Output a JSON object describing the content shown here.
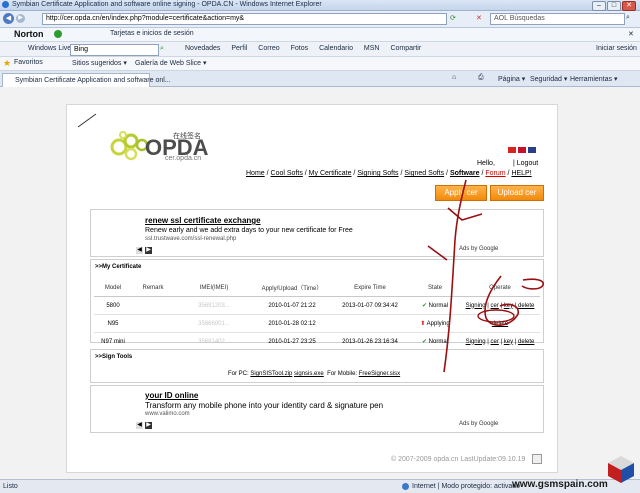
{
  "window": {
    "title": "Symbian Certificate Application and software online signing - OPDA.CN - Windows Internet Explorer",
    "minimize": "–",
    "maximize": "□",
    "close": "✕"
  },
  "address": {
    "url": "http://cer.opda.cn/en/index.php?module=certificate&action=my&",
    "search_placeholder": "AOL Búsquedas"
  },
  "norton": {
    "brand": "Norton",
    "cards": "Tarjetas e inicios de sesión"
  },
  "winlive": {
    "brand": "Windows Live",
    "search_value": "Bing",
    "items": [
      "Novedades",
      "Perfil",
      "Correo",
      "Fotos",
      "Calendario",
      "MSN",
      "Compartir"
    ],
    "signin": "Iniciar sesión"
  },
  "favorites": {
    "label": "Favoritos",
    "items": [
      "Sitios sugeridos ▾",
      "Galería de Web Slice ▾"
    ]
  },
  "tab": {
    "label": "Symbian Certificate Application and software onl...",
    "commands": [
      "Página ▾",
      "Seguridad ▾",
      "Herramientas ▾"
    ]
  },
  "site": {
    "logo_name": "OPDA",
    "logo_cn": "在线签名",
    "logo_domain": "cer.opda.cn",
    "hello": "Hello,",
    "logout": "| Logout",
    "nav": [
      "Home",
      "Cool Softs",
      "My Certificate",
      "Signing Softs",
      "Signed Softs",
      "Software",
      "Forum",
      "HELP!"
    ],
    "apply_btn": "Apply cer",
    "upload_btn": "Upload cer"
  },
  "ad1": {
    "headline": "renew ssl certificate exchange",
    "text": "Renew early and we add extra days to your new certificate for Free",
    "url": "ssl.trustwave.com/ssl-renewal.php",
    "adsby": "Ads by Google"
  },
  "mycert": {
    "section_title": ">>My Certificate",
    "columns": [
      "Model",
      "Remark",
      "IMEI(IMEI)",
      "Apply/Upload（Time）",
      "Expire Time",
      "State",
      "Operate"
    ],
    "rows": [
      {
        "model": "5800",
        "remark": "",
        "imei": "35691203...",
        "apply": "2010-01-07 21:22",
        "expire": "2013-01-07 09:34:42",
        "state": "Normal",
        "state_icon": "check",
        "ops": [
          "Signing",
          "cer",
          "key",
          "delete"
        ]
      },
      {
        "model": "N95",
        "remark": "",
        "imei": "35666001...",
        "apply": "2010-01-28 02:12",
        "expire": "",
        "state": "Applying",
        "state_icon": "arrow",
        "ops": [
          "delete"
        ]
      },
      {
        "model": "N97 mini",
        "remark": "",
        "imei": "35681402...",
        "apply": "2010-01-27 23:25",
        "expire": "2013-01-26 23:16:34",
        "state": "Normal",
        "state_icon": "check",
        "ops": [
          "Signing",
          "cer",
          "key",
          "delete"
        ]
      }
    ]
  },
  "signtools": {
    "section_title": ">>Sign Tools",
    "pc_label": "For PC:",
    "pc_links": [
      "SignSISTool.zip",
      "signsis.exe"
    ],
    "mobile_label": "For Mobile:",
    "mobile_links": [
      "FreeSigner.sisx"
    ]
  },
  "ad2": {
    "headline": "your ID online",
    "text": "Transform any mobile phone into your identity card & signature pen",
    "url": "www.valimo.com",
    "adsby": "Ads by Google"
  },
  "footer": {
    "copyright": "© 2007-2009 opda.cn LastUpdate:09.10.19"
  },
  "status": {
    "left": "Listo",
    "zone": "Internet | Modo protegido: activado",
    "watermark": "www.gsmspain.com"
  }
}
